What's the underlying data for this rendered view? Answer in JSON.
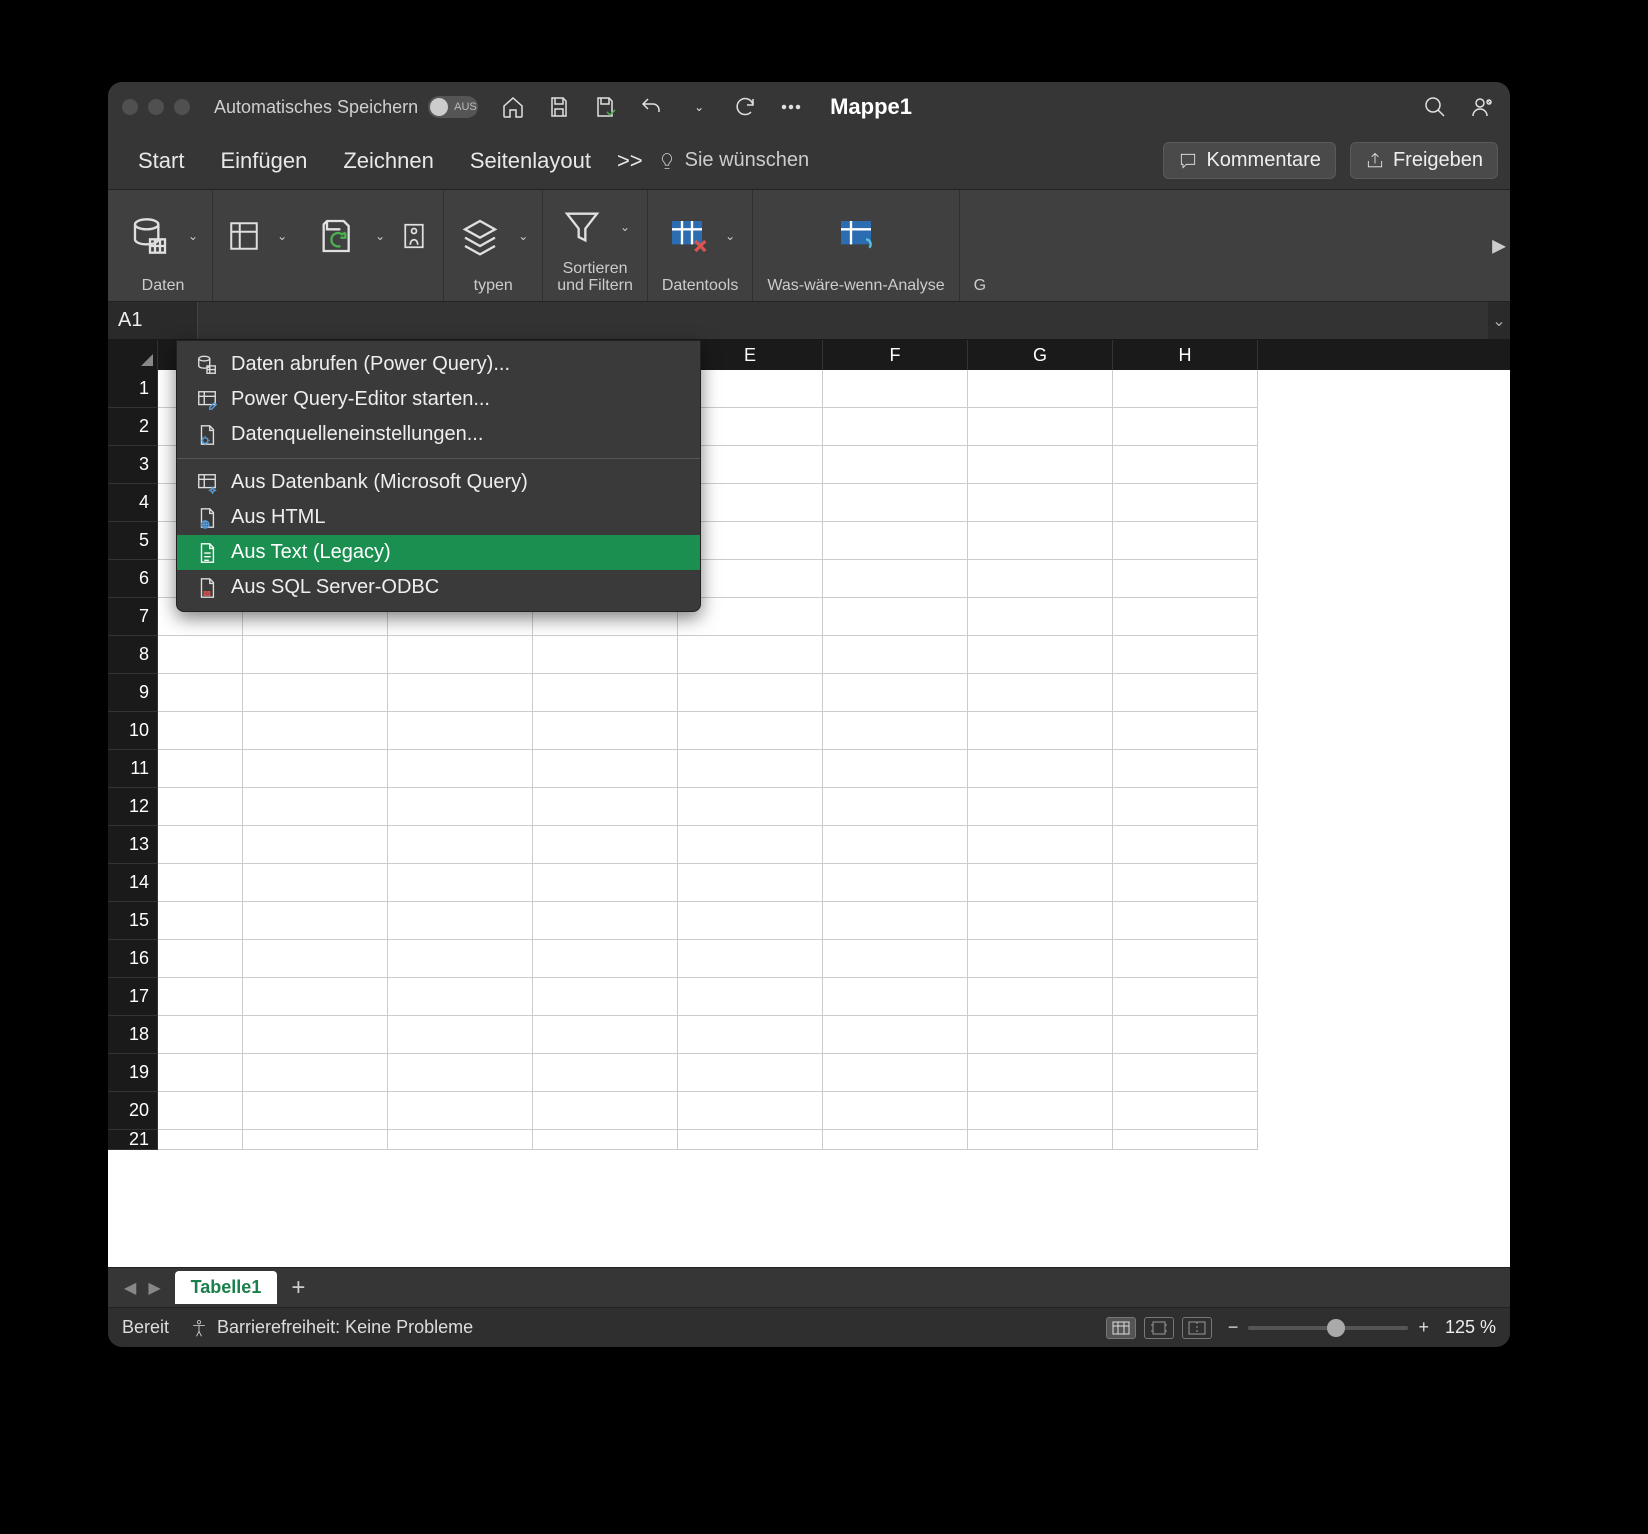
{
  "title": {
    "autosave_label": "Automatisches Speichern",
    "autosave_state": "AUS",
    "document": "Mappe1"
  },
  "tabs": {
    "t0": "Start",
    "t1": "Einfügen",
    "t2": "Zeichnen",
    "t3": "Seitenlayout",
    "more": ">>",
    "tellme": "Sie wünschen",
    "comments": "Kommentare",
    "share": "Freigeben"
  },
  "ribbon": {
    "g0": "Daten",
    "g3": "typen",
    "g4": "Sortieren\nund Filtern",
    "g5": "Datentools",
    "g6": "Was-wäre-wenn-Analyse",
    "g7": "G"
  },
  "namebox": "A1",
  "columns": [
    "E",
    "F",
    "G",
    "H"
  ],
  "rows": [
    "1",
    "2",
    "3",
    "4",
    "5",
    "6",
    "7",
    "8",
    "9",
    "10",
    "11",
    "12",
    "13",
    "14",
    "15",
    "16",
    "17",
    "18",
    "19",
    "20",
    "21"
  ],
  "menu": {
    "m0": "Daten abrufen (Power Query)...",
    "m1": "Power Query-Editor starten...",
    "m2": "Datenquelleneinstellungen...",
    "m3": "Aus Datenbank (Microsoft Query)",
    "m4": "Aus HTML",
    "m5": "Aus Text (Legacy)",
    "m6": "Aus SQL Server-ODBC"
  },
  "sheet": {
    "tab": "Tabelle1"
  },
  "status": {
    "ready": "Bereit",
    "a11y": "Barrierefreiheit: Keine Probleme",
    "zoom": "125 %"
  }
}
